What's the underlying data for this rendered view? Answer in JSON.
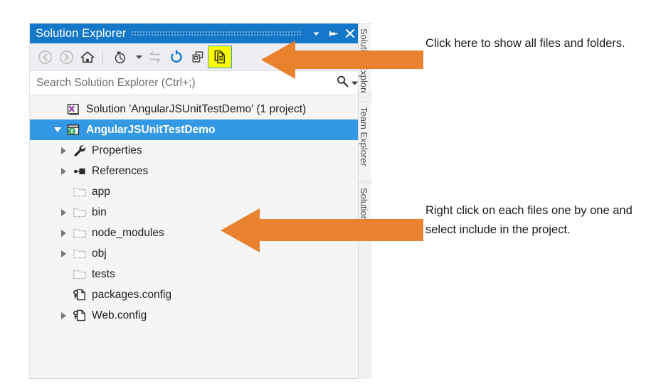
{
  "window": {
    "title": "Solution Explorer",
    "title_bar_color": "#1577c8",
    "buttons": [
      {
        "name": "dropdown",
        "label": "▼"
      },
      {
        "name": "pin",
        "label": "Pin"
      },
      {
        "name": "close",
        "label": "✕"
      }
    ]
  },
  "toolbar": {
    "items": [
      {
        "name": "back",
        "label": "Back",
        "enabled": false
      },
      {
        "name": "forward",
        "label": "Forward",
        "enabled": false
      },
      {
        "name": "home",
        "label": "Home",
        "enabled": true
      },
      {
        "name": "pending-changes",
        "label": "Pending Changes Filter",
        "enabled": true,
        "has_dropdown": true
      },
      {
        "name": "sync-with-active-document",
        "label": "Sync with Active Document",
        "enabled": false
      },
      {
        "name": "refresh",
        "label": "Refresh",
        "enabled": true
      },
      {
        "name": "collapse-all",
        "label": "Collapse All",
        "enabled": true
      },
      {
        "name": "show-all-files",
        "label": "Show All Files",
        "enabled": true,
        "highlighted": true,
        "highlight_color": "#ffff00"
      }
    ]
  },
  "search": {
    "placeholder": "Search Solution Explorer (Ctrl+;)",
    "value": "",
    "icon": "search-icon",
    "dropdown_icon": "chevron-down-icon"
  },
  "tree": {
    "nodes": [
      {
        "label": "Solution 'AngularJSUnitTestDemo' (1 project)",
        "icon": "solution-icon",
        "indent": 0,
        "expander": "none",
        "selected": false
      },
      {
        "label": "AngularJSUnitTestDemo",
        "icon": "web-project-icon",
        "indent": 0,
        "expander": "open",
        "selected": true
      },
      {
        "label": "Properties",
        "icon": "wrench-icon",
        "indent": 1,
        "expander": "closed",
        "selected": false
      },
      {
        "label": "References",
        "icon": "references-icon",
        "indent": 1,
        "expander": "closed",
        "selected": false
      },
      {
        "label": "app",
        "icon": "folder-excluded-icon",
        "indent": 1,
        "expander": "none",
        "selected": false
      },
      {
        "label": "bin",
        "icon": "folder-excluded-icon",
        "indent": 1,
        "expander": "closed",
        "selected": false
      },
      {
        "label": "node_modules",
        "icon": "folder-excluded-icon",
        "indent": 1,
        "expander": "closed",
        "selected": false
      },
      {
        "label": "obj",
        "icon": "folder-excluded-icon",
        "indent": 1,
        "expander": "closed",
        "selected": false
      },
      {
        "label": "tests",
        "icon": "folder-excluded-icon",
        "indent": 1,
        "expander": "none",
        "selected": false
      },
      {
        "label": "packages.config",
        "icon": "config-file-icon",
        "indent": 1,
        "expander": "none",
        "selected": false
      },
      {
        "label": "Web.config",
        "icon": "config-file-icon",
        "indent": 1,
        "expander": "closed",
        "selected": false
      }
    ]
  },
  "dock_strip": {
    "tabs": [
      {
        "label": "Solution Explorer",
        "active": true
      },
      {
        "label": "Team Explorer",
        "active": false
      },
      {
        "label": "Solution Explorer",
        "active": false
      }
    ]
  },
  "annotations": {
    "arrow_color": "#e8822f",
    "items": [
      {
        "name": "show-all-files-callout",
        "text": "Click here to show all files and folders.",
        "arrow_direction": "left"
      },
      {
        "name": "include-in-project-callout",
        "text": "Right click on each files one by one and select include in the project.",
        "arrow_direction": "left"
      }
    ]
  }
}
